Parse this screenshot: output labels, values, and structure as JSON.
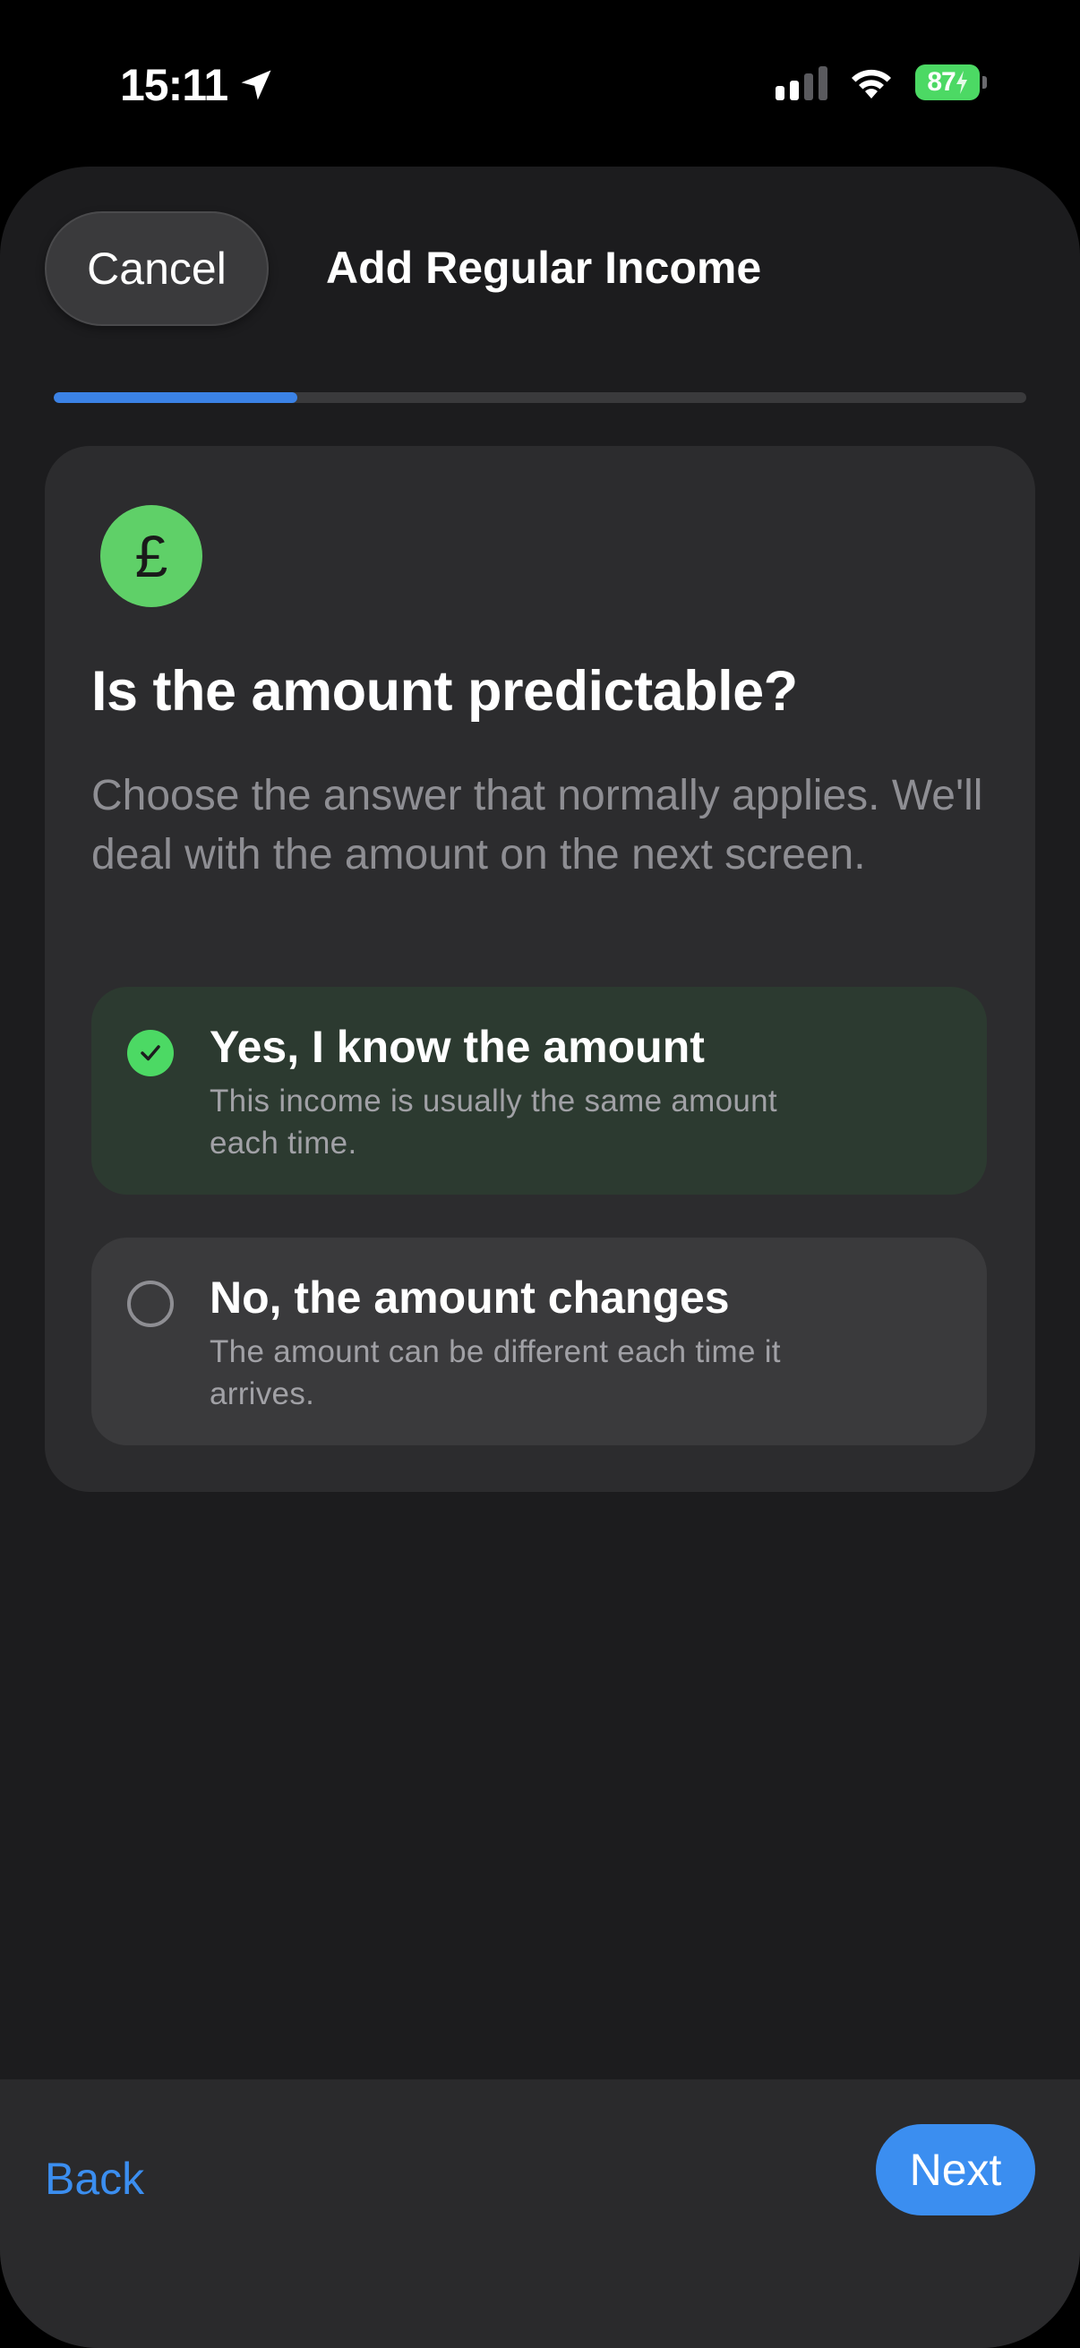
{
  "status_bar": {
    "time": "15:11",
    "battery_percent": "87"
  },
  "header": {
    "cancel_label": "Cancel",
    "title": "Add Regular Income"
  },
  "progress": {
    "fraction": 0.25
  },
  "card": {
    "icon_glyph": "£",
    "question": "Is the amount predictable?",
    "description": "Choose the answer that normally applies. We'll deal with the amount on the next screen.",
    "options": [
      {
        "title": "Yes, I know the amount",
        "subtitle": "This income is usually the same amount each time.",
        "selected": true
      },
      {
        "title": "No, the amount changes",
        "subtitle": "The amount can be different each time it arrives.",
        "selected": false
      }
    ]
  },
  "footer": {
    "back_label": "Back",
    "next_label": "Next"
  },
  "colors": {
    "accent_blue": "#3b8ef0",
    "success_green": "#4cd964",
    "sheet_bg": "#1c1c1e",
    "card_bg": "#2c2c2e"
  }
}
